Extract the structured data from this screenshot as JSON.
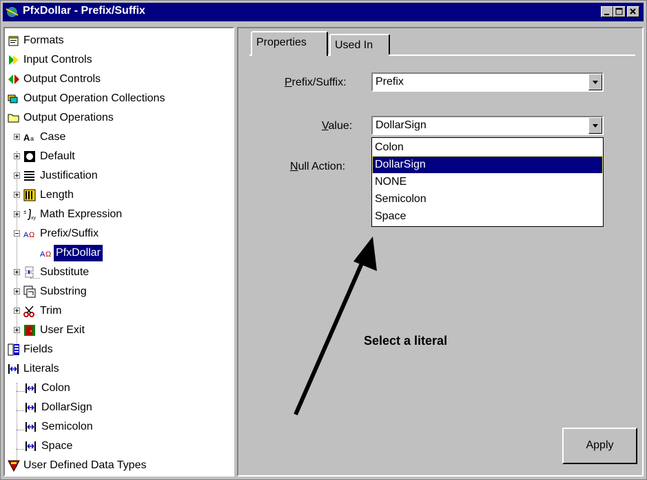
{
  "window": {
    "title": "PfxDollar - Prefix/Suffix"
  },
  "tree": {
    "items": [
      {
        "label": "Formats",
        "icon": "formats-icon"
      },
      {
        "label": "Input Controls",
        "icon": "input-controls-icon"
      },
      {
        "label": "Output Controls",
        "icon": "output-controls-icon"
      },
      {
        "label": "Output Operation Collections",
        "icon": "collections-icon"
      },
      {
        "label": "Output Operations",
        "icon": "folder-icon"
      },
      {
        "label": "Case",
        "icon": "case-icon"
      },
      {
        "label": "Default",
        "icon": "default-icon"
      },
      {
        "label": "Justification",
        "icon": "justification-icon"
      },
      {
        "label": "Length",
        "icon": "length-icon"
      },
      {
        "label": "Math Expression",
        "icon": "math-expression-icon"
      },
      {
        "label": "Prefix/Suffix",
        "icon": "prefix-suffix-icon"
      },
      {
        "label": "PfxDollar",
        "icon": "prefix-suffix-icon"
      },
      {
        "label": "Substitute",
        "icon": "substitute-icon"
      },
      {
        "label": "Substring",
        "icon": "substring-icon"
      },
      {
        "label": "Trim",
        "icon": "trim-icon"
      },
      {
        "label": "User Exit",
        "icon": "user-exit-icon"
      },
      {
        "label": "Fields",
        "icon": "fields-icon"
      },
      {
        "label": "Literals",
        "icon": "literals-icon"
      },
      {
        "label": "Colon",
        "icon": "literal-icon"
      },
      {
        "label": "DollarSign",
        "icon": "literal-icon"
      },
      {
        "label": "Semicolon",
        "icon": "literal-icon"
      },
      {
        "label": "Space",
        "icon": "literal-icon"
      },
      {
        "label": "User Defined Data Types",
        "icon": "user-data-types-icon"
      }
    ]
  },
  "tabs": [
    {
      "label": "Properties"
    },
    {
      "label": "Used In"
    }
  ],
  "form": {
    "prefix_suffix": {
      "label_mnemonic": "P",
      "label_rest": "refix/Suffix:",
      "value": "Prefix"
    },
    "value": {
      "label_mnemonic": "V",
      "label_rest": "alue:",
      "value": "DollarSign"
    },
    "null_action": {
      "label_mnemonic": "N",
      "label_rest": "ull Action:"
    }
  },
  "dropdown": {
    "options": [
      "Colon",
      "DollarSign",
      "NONE",
      "Semicolon",
      "Space"
    ],
    "selected": "DollarSign"
  },
  "annotation": {
    "text": "Select a literal"
  },
  "apply_label": "Apply",
  "colors": {
    "titlebar": "#000080",
    "selection": "#000080",
    "face": "#c0c0c0"
  }
}
